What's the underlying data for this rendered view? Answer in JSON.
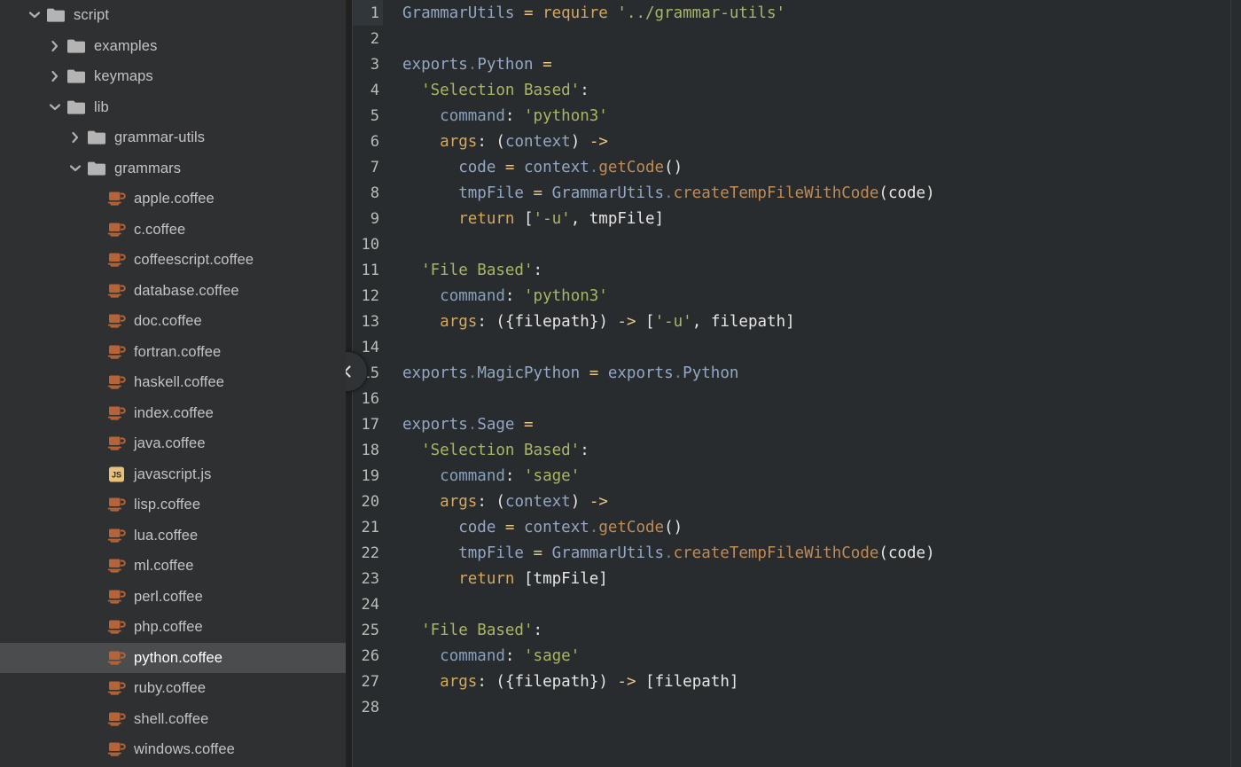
{
  "app": {
    "theme_bg": "#282c2e",
    "sidebar_bg": "#2e3032",
    "selected_bg": "#4a4c4e",
    "accent_coffee": "#b5643a",
    "accent_js": "#e8c07a"
  },
  "sidebar": {
    "name": "tree-view",
    "items": [
      {
        "label": "script",
        "type": "folder",
        "depth": 0,
        "expanded": true,
        "icon": "chevron-down-icon"
      },
      {
        "label": "examples",
        "type": "folder",
        "depth": 1,
        "expanded": false,
        "icon": "chevron-right-icon"
      },
      {
        "label": "keymaps",
        "type": "folder",
        "depth": 1,
        "expanded": false,
        "icon": "chevron-right-icon"
      },
      {
        "label": "lib",
        "type": "folder",
        "depth": 1,
        "expanded": true,
        "icon": "chevron-down-icon"
      },
      {
        "label": "grammar-utils",
        "type": "folder",
        "depth": 2,
        "expanded": false,
        "icon": "chevron-right-icon"
      },
      {
        "label": "grammars",
        "type": "folder",
        "depth": 2,
        "expanded": true,
        "icon": "chevron-down-icon"
      },
      {
        "label": "apple.coffee",
        "type": "coffee",
        "depth": 3,
        "selected": false
      },
      {
        "label": "c.coffee",
        "type": "coffee",
        "depth": 3,
        "selected": false
      },
      {
        "label": "coffeescript.coffee",
        "type": "coffee",
        "depth": 3,
        "selected": false
      },
      {
        "label": "database.coffee",
        "type": "coffee",
        "depth": 3,
        "selected": false
      },
      {
        "label": "doc.coffee",
        "type": "coffee",
        "depth": 3,
        "selected": false
      },
      {
        "label": "fortran.coffee",
        "type": "coffee",
        "depth": 3,
        "selected": false
      },
      {
        "label": "haskell.coffee",
        "type": "coffee",
        "depth": 3,
        "selected": false
      },
      {
        "label": "index.coffee",
        "type": "coffee",
        "depth": 3,
        "selected": false
      },
      {
        "label": "java.coffee",
        "type": "coffee",
        "depth": 3,
        "selected": false
      },
      {
        "label": "javascript.js",
        "type": "js",
        "depth": 3,
        "selected": false
      },
      {
        "label": "lisp.coffee",
        "type": "coffee",
        "depth": 3,
        "selected": false
      },
      {
        "label": "lua.coffee",
        "type": "coffee",
        "depth": 3,
        "selected": false
      },
      {
        "label": "ml.coffee",
        "type": "coffee",
        "depth": 3,
        "selected": false
      },
      {
        "label": "perl.coffee",
        "type": "coffee",
        "depth": 3,
        "selected": false
      },
      {
        "label": "php.coffee",
        "type": "coffee",
        "depth": 3,
        "selected": false
      },
      {
        "label": "python.coffee",
        "type": "coffee",
        "depth": 3,
        "selected": true
      },
      {
        "label": "ruby.coffee",
        "type": "coffee",
        "depth": 3,
        "selected": false
      },
      {
        "label": "shell.coffee",
        "type": "coffee",
        "depth": 3,
        "selected": false
      },
      {
        "label": "windows.coffee",
        "type": "coffee",
        "depth": 3,
        "selected": false
      }
    ]
  },
  "editor": {
    "name": "code-editor",
    "current_line": 1,
    "collapse_handle_label": "‹",
    "lines": [
      {
        "n": "1",
        "tokens": [
          {
            "t": "GrammarUtils",
            "c": "t-var"
          },
          {
            "t": " ",
            "c": "t-plain"
          },
          {
            "t": "=",
            "c": "t-op"
          },
          {
            "t": " ",
            "c": "t-plain"
          },
          {
            "t": "require",
            "c": "t-kw"
          },
          {
            "t": " ",
            "c": "t-plain"
          },
          {
            "t": "'../grammar-utils'",
            "c": "t-str"
          }
        ]
      },
      {
        "n": "2",
        "tokens": []
      },
      {
        "n": "3",
        "tokens": [
          {
            "t": "exports",
            "c": "t-var"
          },
          {
            "t": ".",
            "c": "t-dot"
          },
          {
            "t": "Python",
            "c": "t-var"
          },
          {
            "t": " ",
            "c": "t-plain"
          },
          {
            "t": "=",
            "c": "t-op"
          }
        ]
      },
      {
        "n": "4",
        "tokens": [
          {
            "t": "  ",
            "c": "t-plain"
          },
          {
            "t": "'Selection Based'",
            "c": "t-str"
          },
          {
            "t": ":",
            "c": "t-plain"
          }
        ]
      },
      {
        "n": "5",
        "tokens": [
          {
            "t": "    ",
            "c": "t-plain"
          },
          {
            "t": "command",
            "c": "t-key"
          },
          {
            "t": ":",
            "c": "t-plain"
          },
          {
            "t": " ",
            "c": "t-plain"
          },
          {
            "t": "'python3'",
            "c": "t-str"
          }
        ]
      },
      {
        "n": "6",
        "tokens": [
          {
            "t": "    ",
            "c": "t-plain"
          },
          {
            "t": "args",
            "c": "t-kw"
          },
          {
            "t": ":",
            "c": "t-plain"
          },
          {
            "t": " ",
            "c": "t-plain"
          },
          {
            "t": "(",
            "c": "t-punct"
          },
          {
            "t": "context",
            "c": "t-var"
          },
          {
            "t": ")",
            "c": "t-punct"
          },
          {
            "t": " ",
            "c": "t-plain"
          },
          {
            "t": "->",
            "c": "t-arrow"
          }
        ]
      },
      {
        "n": "7",
        "tokens": [
          {
            "t": "      ",
            "c": "t-plain"
          },
          {
            "t": "code",
            "c": "t-var"
          },
          {
            "t": " ",
            "c": "t-plain"
          },
          {
            "t": "=",
            "c": "t-op"
          },
          {
            "t": " ",
            "c": "t-plain"
          },
          {
            "t": "context",
            "c": "t-var"
          },
          {
            "t": ".",
            "c": "t-dot"
          },
          {
            "t": "getCode",
            "c": "t-fn"
          },
          {
            "t": "()",
            "c": "t-punct"
          }
        ]
      },
      {
        "n": "8",
        "tokens": [
          {
            "t": "      ",
            "c": "t-plain"
          },
          {
            "t": "tmpFile",
            "c": "t-var"
          },
          {
            "t": " ",
            "c": "t-plain"
          },
          {
            "t": "=",
            "c": "t-op"
          },
          {
            "t": " ",
            "c": "t-plain"
          },
          {
            "t": "GrammarUtils",
            "c": "t-var"
          },
          {
            "t": ".",
            "c": "t-dot"
          },
          {
            "t": "createTempFileWithCode",
            "c": "t-fn"
          },
          {
            "t": "(",
            "c": "t-punct"
          },
          {
            "t": "code",
            "c": "t-punct"
          },
          {
            "t": ")",
            "c": "t-punct"
          }
        ]
      },
      {
        "n": "9",
        "tokens": [
          {
            "t": "      ",
            "c": "t-plain"
          },
          {
            "t": "return",
            "c": "t-kw"
          },
          {
            "t": " ",
            "c": "t-plain"
          },
          {
            "t": "[",
            "c": "t-punct"
          },
          {
            "t": "'-u'",
            "c": "t-str"
          },
          {
            "t": ", ",
            "c": "t-punct"
          },
          {
            "t": "tmpFile",
            "c": "t-punct"
          },
          {
            "t": "]",
            "c": "t-punct"
          }
        ]
      },
      {
        "n": "10",
        "tokens": []
      },
      {
        "n": "11",
        "tokens": [
          {
            "t": "  ",
            "c": "t-plain"
          },
          {
            "t": "'File Based'",
            "c": "t-str"
          },
          {
            "t": ":",
            "c": "t-plain"
          }
        ]
      },
      {
        "n": "12",
        "tokens": [
          {
            "t": "    ",
            "c": "t-plain"
          },
          {
            "t": "command",
            "c": "t-key"
          },
          {
            "t": ":",
            "c": "t-plain"
          },
          {
            "t": " ",
            "c": "t-plain"
          },
          {
            "t": "'python3'",
            "c": "t-str"
          }
        ]
      },
      {
        "n": "13",
        "tokens": [
          {
            "t": "    ",
            "c": "t-plain"
          },
          {
            "t": "args",
            "c": "t-kw"
          },
          {
            "t": ":",
            "c": "t-plain"
          },
          {
            "t": " ",
            "c": "t-plain"
          },
          {
            "t": "({",
            "c": "t-punct"
          },
          {
            "t": "filepath",
            "c": "t-punct"
          },
          {
            "t": "})",
            "c": "t-punct"
          },
          {
            "t": " ",
            "c": "t-plain"
          },
          {
            "t": "->",
            "c": "t-arrow"
          },
          {
            "t": " ",
            "c": "t-plain"
          },
          {
            "t": "[",
            "c": "t-punct"
          },
          {
            "t": "'-u'",
            "c": "t-str"
          },
          {
            "t": ", ",
            "c": "t-punct"
          },
          {
            "t": "filepath",
            "c": "t-punct"
          },
          {
            "t": "]",
            "c": "t-punct"
          }
        ]
      },
      {
        "n": "14",
        "tokens": []
      },
      {
        "n": "15",
        "tokens": [
          {
            "t": "exports",
            "c": "t-var"
          },
          {
            "t": ".",
            "c": "t-dot"
          },
          {
            "t": "MagicPython",
            "c": "t-var"
          },
          {
            "t": " ",
            "c": "t-plain"
          },
          {
            "t": "=",
            "c": "t-op"
          },
          {
            "t": " ",
            "c": "t-plain"
          },
          {
            "t": "exports",
            "c": "t-var"
          },
          {
            "t": ".",
            "c": "t-dot"
          },
          {
            "t": "Python",
            "c": "t-var"
          }
        ]
      },
      {
        "n": "16",
        "tokens": []
      },
      {
        "n": "17",
        "tokens": [
          {
            "t": "exports",
            "c": "t-var"
          },
          {
            "t": ".",
            "c": "t-dot"
          },
          {
            "t": "Sage",
            "c": "t-var"
          },
          {
            "t": " ",
            "c": "t-plain"
          },
          {
            "t": "=",
            "c": "t-op"
          }
        ]
      },
      {
        "n": "18",
        "tokens": [
          {
            "t": "  ",
            "c": "t-plain"
          },
          {
            "t": "'Selection Based'",
            "c": "t-str"
          },
          {
            "t": ":",
            "c": "t-plain"
          }
        ]
      },
      {
        "n": "19",
        "tokens": [
          {
            "t": "    ",
            "c": "t-plain"
          },
          {
            "t": "command",
            "c": "t-key"
          },
          {
            "t": ":",
            "c": "t-plain"
          },
          {
            "t": " ",
            "c": "t-plain"
          },
          {
            "t": "'sage'",
            "c": "t-str"
          }
        ]
      },
      {
        "n": "20",
        "tokens": [
          {
            "t": "    ",
            "c": "t-plain"
          },
          {
            "t": "args",
            "c": "t-kw"
          },
          {
            "t": ":",
            "c": "t-plain"
          },
          {
            "t": " ",
            "c": "t-plain"
          },
          {
            "t": "(",
            "c": "t-punct"
          },
          {
            "t": "context",
            "c": "t-var"
          },
          {
            "t": ")",
            "c": "t-punct"
          },
          {
            "t": " ",
            "c": "t-plain"
          },
          {
            "t": "->",
            "c": "t-arrow"
          }
        ]
      },
      {
        "n": "21",
        "tokens": [
          {
            "t": "      ",
            "c": "t-plain"
          },
          {
            "t": "code",
            "c": "t-var"
          },
          {
            "t": " ",
            "c": "t-plain"
          },
          {
            "t": "=",
            "c": "t-op"
          },
          {
            "t": " ",
            "c": "t-plain"
          },
          {
            "t": "context",
            "c": "t-var"
          },
          {
            "t": ".",
            "c": "t-dot"
          },
          {
            "t": "getCode",
            "c": "t-fn"
          },
          {
            "t": "()",
            "c": "t-punct"
          }
        ]
      },
      {
        "n": "22",
        "tokens": [
          {
            "t": "      ",
            "c": "t-plain"
          },
          {
            "t": "tmpFile",
            "c": "t-var"
          },
          {
            "t": " ",
            "c": "t-plain"
          },
          {
            "t": "=",
            "c": "t-op"
          },
          {
            "t": " ",
            "c": "t-plain"
          },
          {
            "t": "GrammarUtils",
            "c": "t-var"
          },
          {
            "t": ".",
            "c": "t-dot"
          },
          {
            "t": "createTempFileWithCode",
            "c": "t-fn"
          },
          {
            "t": "(",
            "c": "t-punct"
          },
          {
            "t": "code",
            "c": "t-punct"
          },
          {
            "t": ")",
            "c": "t-punct"
          }
        ]
      },
      {
        "n": "23",
        "tokens": [
          {
            "t": "      ",
            "c": "t-plain"
          },
          {
            "t": "return",
            "c": "t-kw"
          },
          {
            "t": " ",
            "c": "t-plain"
          },
          {
            "t": "[",
            "c": "t-punct"
          },
          {
            "t": "tmpFile",
            "c": "t-punct"
          },
          {
            "t": "]",
            "c": "t-punct"
          }
        ]
      },
      {
        "n": "24",
        "tokens": []
      },
      {
        "n": "25",
        "tokens": [
          {
            "t": "  ",
            "c": "t-plain"
          },
          {
            "t": "'File Based'",
            "c": "t-str"
          },
          {
            "t": ":",
            "c": "t-plain"
          }
        ]
      },
      {
        "n": "26",
        "tokens": [
          {
            "t": "    ",
            "c": "t-plain"
          },
          {
            "t": "command",
            "c": "t-key"
          },
          {
            "t": ":",
            "c": "t-plain"
          },
          {
            "t": " ",
            "c": "t-plain"
          },
          {
            "t": "'sage'",
            "c": "t-str"
          }
        ]
      },
      {
        "n": "27",
        "tokens": [
          {
            "t": "    ",
            "c": "t-plain"
          },
          {
            "t": "args",
            "c": "t-kw"
          },
          {
            "t": ":",
            "c": "t-plain"
          },
          {
            "t": " ",
            "c": "t-plain"
          },
          {
            "t": "({",
            "c": "t-punct"
          },
          {
            "t": "filepath",
            "c": "t-punct"
          },
          {
            "t": "})",
            "c": "t-punct"
          },
          {
            "t": " ",
            "c": "t-plain"
          },
          {
            "t": "->",
            "c": "t-arrow"
          },
          {
            "t": " ",
            "c": "t-plain"
          },
          {
            "t": "[",
            "c": "t-punct"
          },
          {
            "t": "filepath",
            "c": "t-punct"
          },
          {
            "t": "]",
            "c": "t-punct"
          }
        ]
      },
      {
        "n": "28",
        "tokens": []
      }
    ]
  }
}
